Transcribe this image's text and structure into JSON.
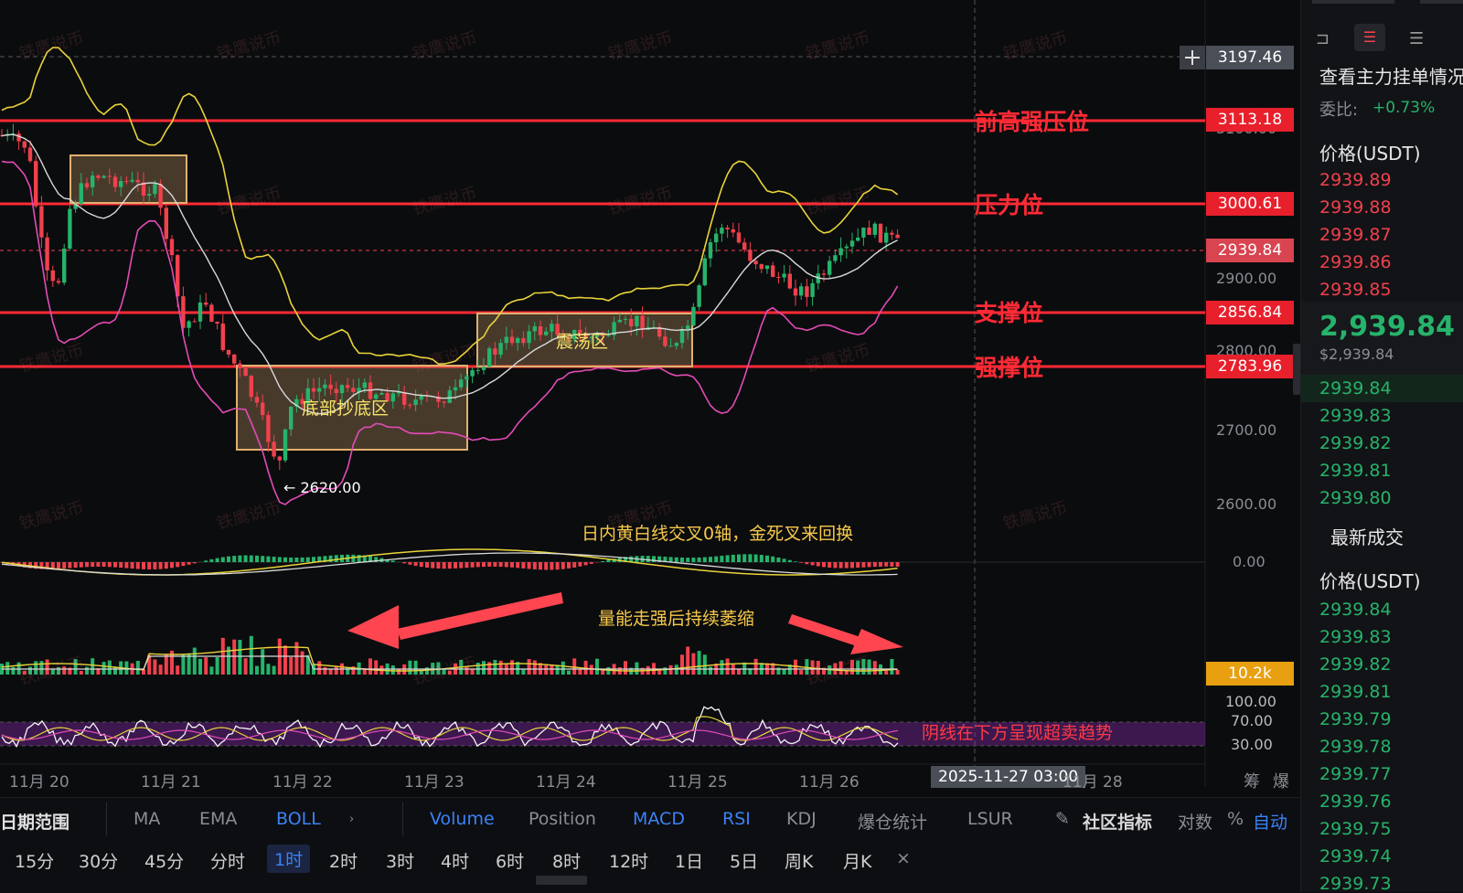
{
  "chart": {
    "top_crosshair_price": "3197.46",
    "levels": [
      {
        "name": "前高强压位",
        "price": "3113.18"
      },
      {
        "name": "压力位",
        "price": "3000.61"
      },
      {
        "name": "支撑位",
        "price": "2856.84"
      },
      {
        "name": "强撑位",
        "price": "2783.96"
      }
    ],
    "current_price_tag": "2939.84",
    "axis_prices": [
      "3100.00",
      "2900.00",
      "2800.00",
      "2700.00",
      "2600.00"
    ],
    "zones": {
      "bottom_zone": "底部抄底区",
      "range_zone": "震荡区"
    },
    "low_marker": "2620.00",
    "macd": {
      "zero_label": "0.00",
      "annotation": "日内黄白线交叉0轴，金死叉来回换"
    },
    "volume": {
      "annotation": "量能走强后持续萎缩",
      "tag": "10.2k"
    },
    "rsi": {
      "levels": [
        "100.00",
        "70.00",
        "30.00"
      ],
      "annotation": "阴线在下方呈现超卖趋势"
    },
    "dates": [
      "11月 20",
      "11月 21",
      "11月 22",
      "11月 23",
      "11月 24",
      "11月 25",
      "11月 26",
      "11月 28"
    ],
    "crosshair_date": "2025-11-27 03:00",
    "right_axis_icons": [
      "筹",
      "爆"
    ],
    "watermark": "铁鹰说币"
  },
  "indicator_bar": {
    "range_label": "日期范围",
    "items": [
      "MA",
      "EMA",
      "BOLL",
      "Volume",
      "Position",
      "MACD",
      "RSI",
      "KDJ",
      "爆仓统计",
      "LSUR",
      "社区指标",
      "对数",
      "%",
      "自动"
    ],
    "active": [
      "BOLL",
      "Volume",
      "MACD",
      "RSI",
      "自动"
    ]
  },
  "timeframes": {
    "items": [
      "15分",
      "30分",
      "45分",
      "分时",
      "1时",
      "2时",
      "3时",
      "4时",
      "6时",
      "8时",
      "12时",
      "1日",
      "5日",
      "周K",
      "月K",
      "×"
    ],
    "active": "1时"
  },
  "orderbook": {
    "title": "查看主力挂单情况",
    "ratio_label": "委比:",
    "ratio_value": "+0.73%",
    "header": "价格(USDT)",
    "asks": [
      "2939.89",
      "2939.88",
      "2939.87",
      "2939.86",
      "2939.85"
    ],
    "last": "2,939.84",
    "last_usd": "$2,939.84",
    "bids": [
      "2939.84",
      "2939.83",
      "2939.82",
      "2939.81",
      "2939.80"
    ],
    "trades_tab": "最新成交",
    "trades_header": "价格(USDT)",
    "trades": [
      "2939.84",
      "2939.83",
      "2939.82",
      "2939.81",
      "2939.79",
      "2939.78",
      "2939.77",
      "2939.76",
      "2939.75",
      "2939.74",
      "2939.73"
    ]
  },
  "colors": {
    "up": "#26b36b",
    "down": "#f0414d",
    "level": "#ff2a35",
    "accent": "#3b82f6",
    "boll_mid": "#d9d9d9",
    "boll_upper": "#e8d33a",
    "boll_lower": "#e24bb6"
  }
}
